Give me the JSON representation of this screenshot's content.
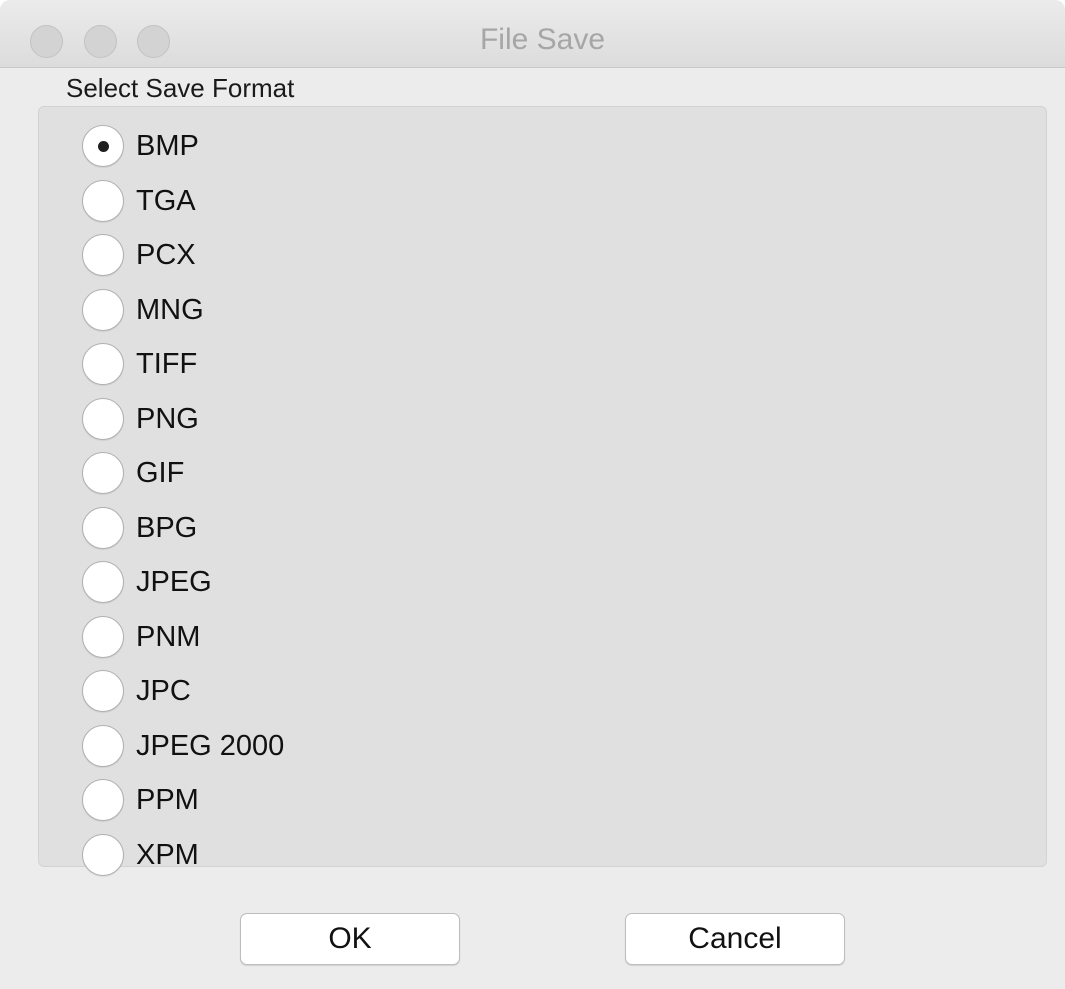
{
  "window": {
    "title": "File Save"
  },
  "group": {
    "label": "Select Save Format",
    "selected": "BMP",
    "options": [
      {
        "label": "BMP",
        "checked": true
      },
      {
        "label": "TGA",
        "checked": false
      },
      {
        "label": "PCX",
        "checked": false
      },
      {
        "label": "MNG",
        "checked": false
      },
      {
        "label": "TIFF",
        "checked": false
      },
      {
        "label": "PNG",
        "checked": false
      },
      {
        "label": "GIF",
        "checked": false
      },
      {
        "label": "BPG",
        "checked": false
      },
      {
        "label": "JPEG",
        "checked": false
      },
      {
        "label": "PNM",
        "checked": false
      },
      {
        "label": "JPC",
        "checked": false
      },
      {
        "label": "JPEG 2000",
        "checked": false
      },
      {
        "label": "PPM",
        "checked": false
      },
      {
        "label": "XPM",
        "checked": false
      }
    ]
  },
  "buttons": {
    "ok_label": "OK",
    "cancel_label": "Cancel"
  },
  "colors": {
    "window_bg": "#ececec",
    "group_bg": "#e0e0e0",
    "title_text": "#a6a6a6",
    "traffic_light_inactive": "#d3d3d3"
  },
  "icons": {
    "close": "close-icon",
    "minimize": "minimize-icon",
    "zoom": "zoom-icon"
  }
}
